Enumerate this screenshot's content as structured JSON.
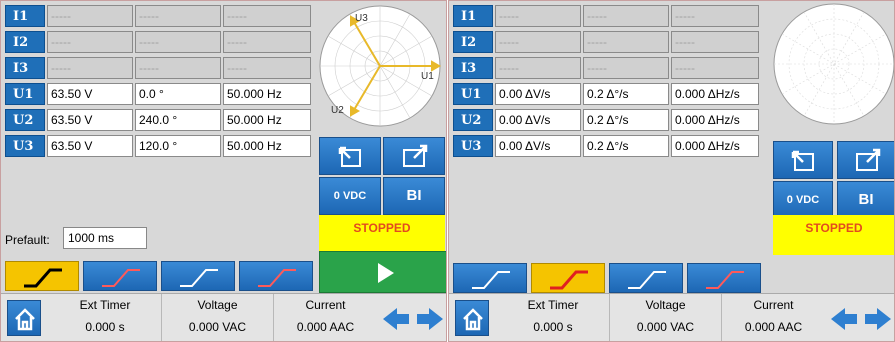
{
  "left": {
    "rows": [
      {
        "chan": "I1",
        "enabled": false,
        "c1": "-----",
        "c2": "-----",
        "c3": "-----"
      },
      {
        "chan": "I2",
        "enabled": false,
        "c1": "-----",
        "c2": "-----",
        "c3": "-----"
      },
      {
        "chan": "I3",
        "enabled": false,
        "c1": "-----",
        "c2": "-----",
        "c3": "-----"
      },
      {
        "chan": "U1",
        "enabled": true,
        "c1": "63.50 V",
        "c2": "0.0 °",
        "c3": "50.000 Hz"
      },
      {
        "chan": "U2",
        "enabled": true,
        "c1": "63.50 V",
        "c2": "240.0 °",
        "c3": "50.000 Hz"
      },
      {
        "chan": "U3",
        "enabled": true,
        "c1": "63.50 V",
        "c2": "120.0 °",
        "c3": "50.000 Hz"
      }
    ],
    "phasor_labels": {
      "u1": "U1",
      "u2": "U2",
      "u3": "U3"
    },
    "prefault_label": "Prefault:",
    "prefault_value": "1000 ms",
    "dc_label": "0 VDC",
    "bi_label": "BI",
    "status": "STOPPED",
    "active_tab": 0
  },
  "right": {
    "rows": [
      {
        "chan": "I1",
        "enabled": false,
        "c1": "-----",
        "c2": "-----",
        "c3": "-----"
      },
      {
        "chan": "I2",
        "enabled": false,
        "c1": "-----",
        "c2": "-----",
        "c3": "-----"
      },
      {
        "chan": "I3",
        "enabled": false,
        "c1": "-----",
        "c2": "-----",
        "c3": "-----"
      },
      {
        "chan": "U1",
        "enabled": true,
        "c1": "0.00 ΔV/s",
        "c2": "0.2 Δ°/s",
        "c3": "0.000 ΔHz/s"
      },
      {
        "chan": "U2",
        "enabled": true,
        "c1": "0.00 ΔV/s",
        "c2": "0.2 Δ°/s",
        "c3": "0.000 ΔHz/s"
      },
      {
        "chan": "U3",
        "enabled": true,
        "c1": "0.00 ΔV/s",
        "c2": "0.2 Δ°/s",
        "c3": "0.000 ΔHz/s"
      }
    ],
    "dc_label": "0 VDC",
    "bi_label": "BI",
    "status": "STOPPED",
    "active_tab": 1
  },
  "statusbar": {
    "ext_timer_label": "Ext Timer",
    "ext_timer_value": "0.000 s",
    "voltage_label": "Voltage",
    "voltage_value": "0.000 VAC",
    "current_label": "Current",
    "current_value": "0.000 AAC"
  },
  "icons": {
    "home": "home-icon",
    "export": "export-icon",
    "edit": "edit-icon",
    "play": "play-icon",
    "prev": "arrow-left-icon",
    "next": "arrow-right-icon",
    "tabs": [
      "ramp-up-icon",
      "ramp-up-icon",
      "ramp-up-icon",
      "ramp-up-icon"
    ]
  },
  "colors": {
    "accent_blue": "#1f6fb8",
    "active_tab": "#f5c400",
    "status_bg": "#ffff00",
    "status_text": "#e34b1e",
    "play_green": "#2aa34a",
    "phasor_yellow": "#e8b92a"
  }
}
